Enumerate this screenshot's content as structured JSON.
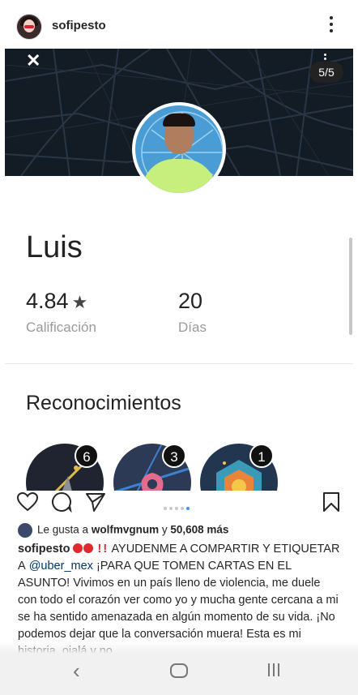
{
  "header": {
    "username": "sofipesto"
  },
  "story": {
    "counter": "5/5",
    "close_glyph": "✕"
  },
  "profile": {
    "name": "Luis",
    "rating_value": "4.84",
    "rating_star": "★",
    "rating_label": "Calificación",
    "days_value": "20",
    "days_label": "Días",
    "recognitions_title": "Reconocimientos",
    "badges": [
      {
        "count": "6",
        "color": "#1f2430",
        "accent": "#e0b94b"
      },
      {
        "count": "3",
        "color": "#2d3a55",
        "accent": "#e46a8e"
      },
      {
        "count": "1",
        "color": "#22374f",
        "accent": "#f2c84b"
      }
    ]
  },
  "actions": {
    "icons": [
      "heart-icon",
      "comment-icon",
      "share-icon",
      "bookmark-icon"
    ],
    "carousel_dots": 5,
    "active_dot": 5
  },
  "post": {
    "likes_prefix": "Le gusta a",
    "likes_user": "wolfmvgnum",
    "likes_joiner": "y",
    "likes_count": "50,608 más",
    "caption_user": "sofipesto",
    "caption_part1": "AYUDENME A COMPARTIR Y ETIQUETAR A",
    "caption_mention": "@uber_mex",
    "caption_part2": "¡PARA QUE TOMEN CARTAS EN EL ASUNTO! Vivimos en un país lleno de violencia, me duele con todo el corazón ver como yo y mucha gente cercana a mi se ha sentido amenazada en algún momento de su vida. ¡No podemos dejar que la conversación muera! Esta es mi historia, ojalá y no"
  },
  "navbar": {
    "back_glyph": "‹"
  },
  "colors": {
    "map_bg": "#131b25",
    "photo_bg": "#4a9cd4",
    "shirt": "#c6ef7e",
    "link": "#003569",
    "active_dot": "#3897f0",
    "emoji_red": "#e0282f"
  }
}
